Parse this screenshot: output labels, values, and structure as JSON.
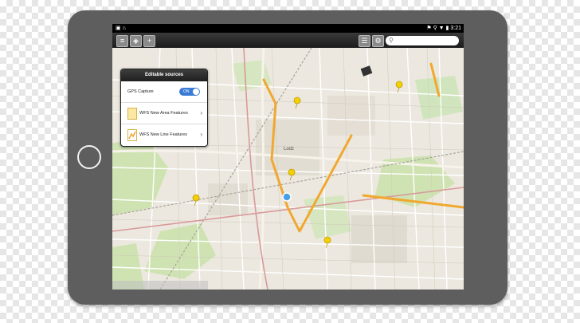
{
  "status_bar": {
    "left_icons": "▣ ⌂",
    "right_icons": "⚑ ⚲ ▼ ▮",
    "time": "3:21"
  },
  "toolbar": {
    "buttons": [
      "menu-icon",
      "layers-icon",
      "add-icon"
    ],
    "right_buttons": [
      "list-icon",
      "gear-icon"
    ],
    "search": {
      "placeholder": ""
    }
  },
  "map": {
    "city_label": "Lodz",
    "route_color": "#f0a830",
    "marker_color": "#f5d000",
    "gps_marker_color": "#4aa0e8"
  },
  "panel": {
    "title": "Editable sources",
    "rows": [
      {
        "label": "GPS Capture",
        "toggle": "ON"
      },
      {
        "label": "WFS New Area Features",
        "icon": "area-icon"
      },
      {
        "label": "WFS New Line Features",
        "icon": "line-icon"
      }
    ]
  },
  "colors": {
    "tablet": "#5e5e5e",
    "toolbar": "#2a2a2a",
    "accent": "#3a7bd5"
  }
}
